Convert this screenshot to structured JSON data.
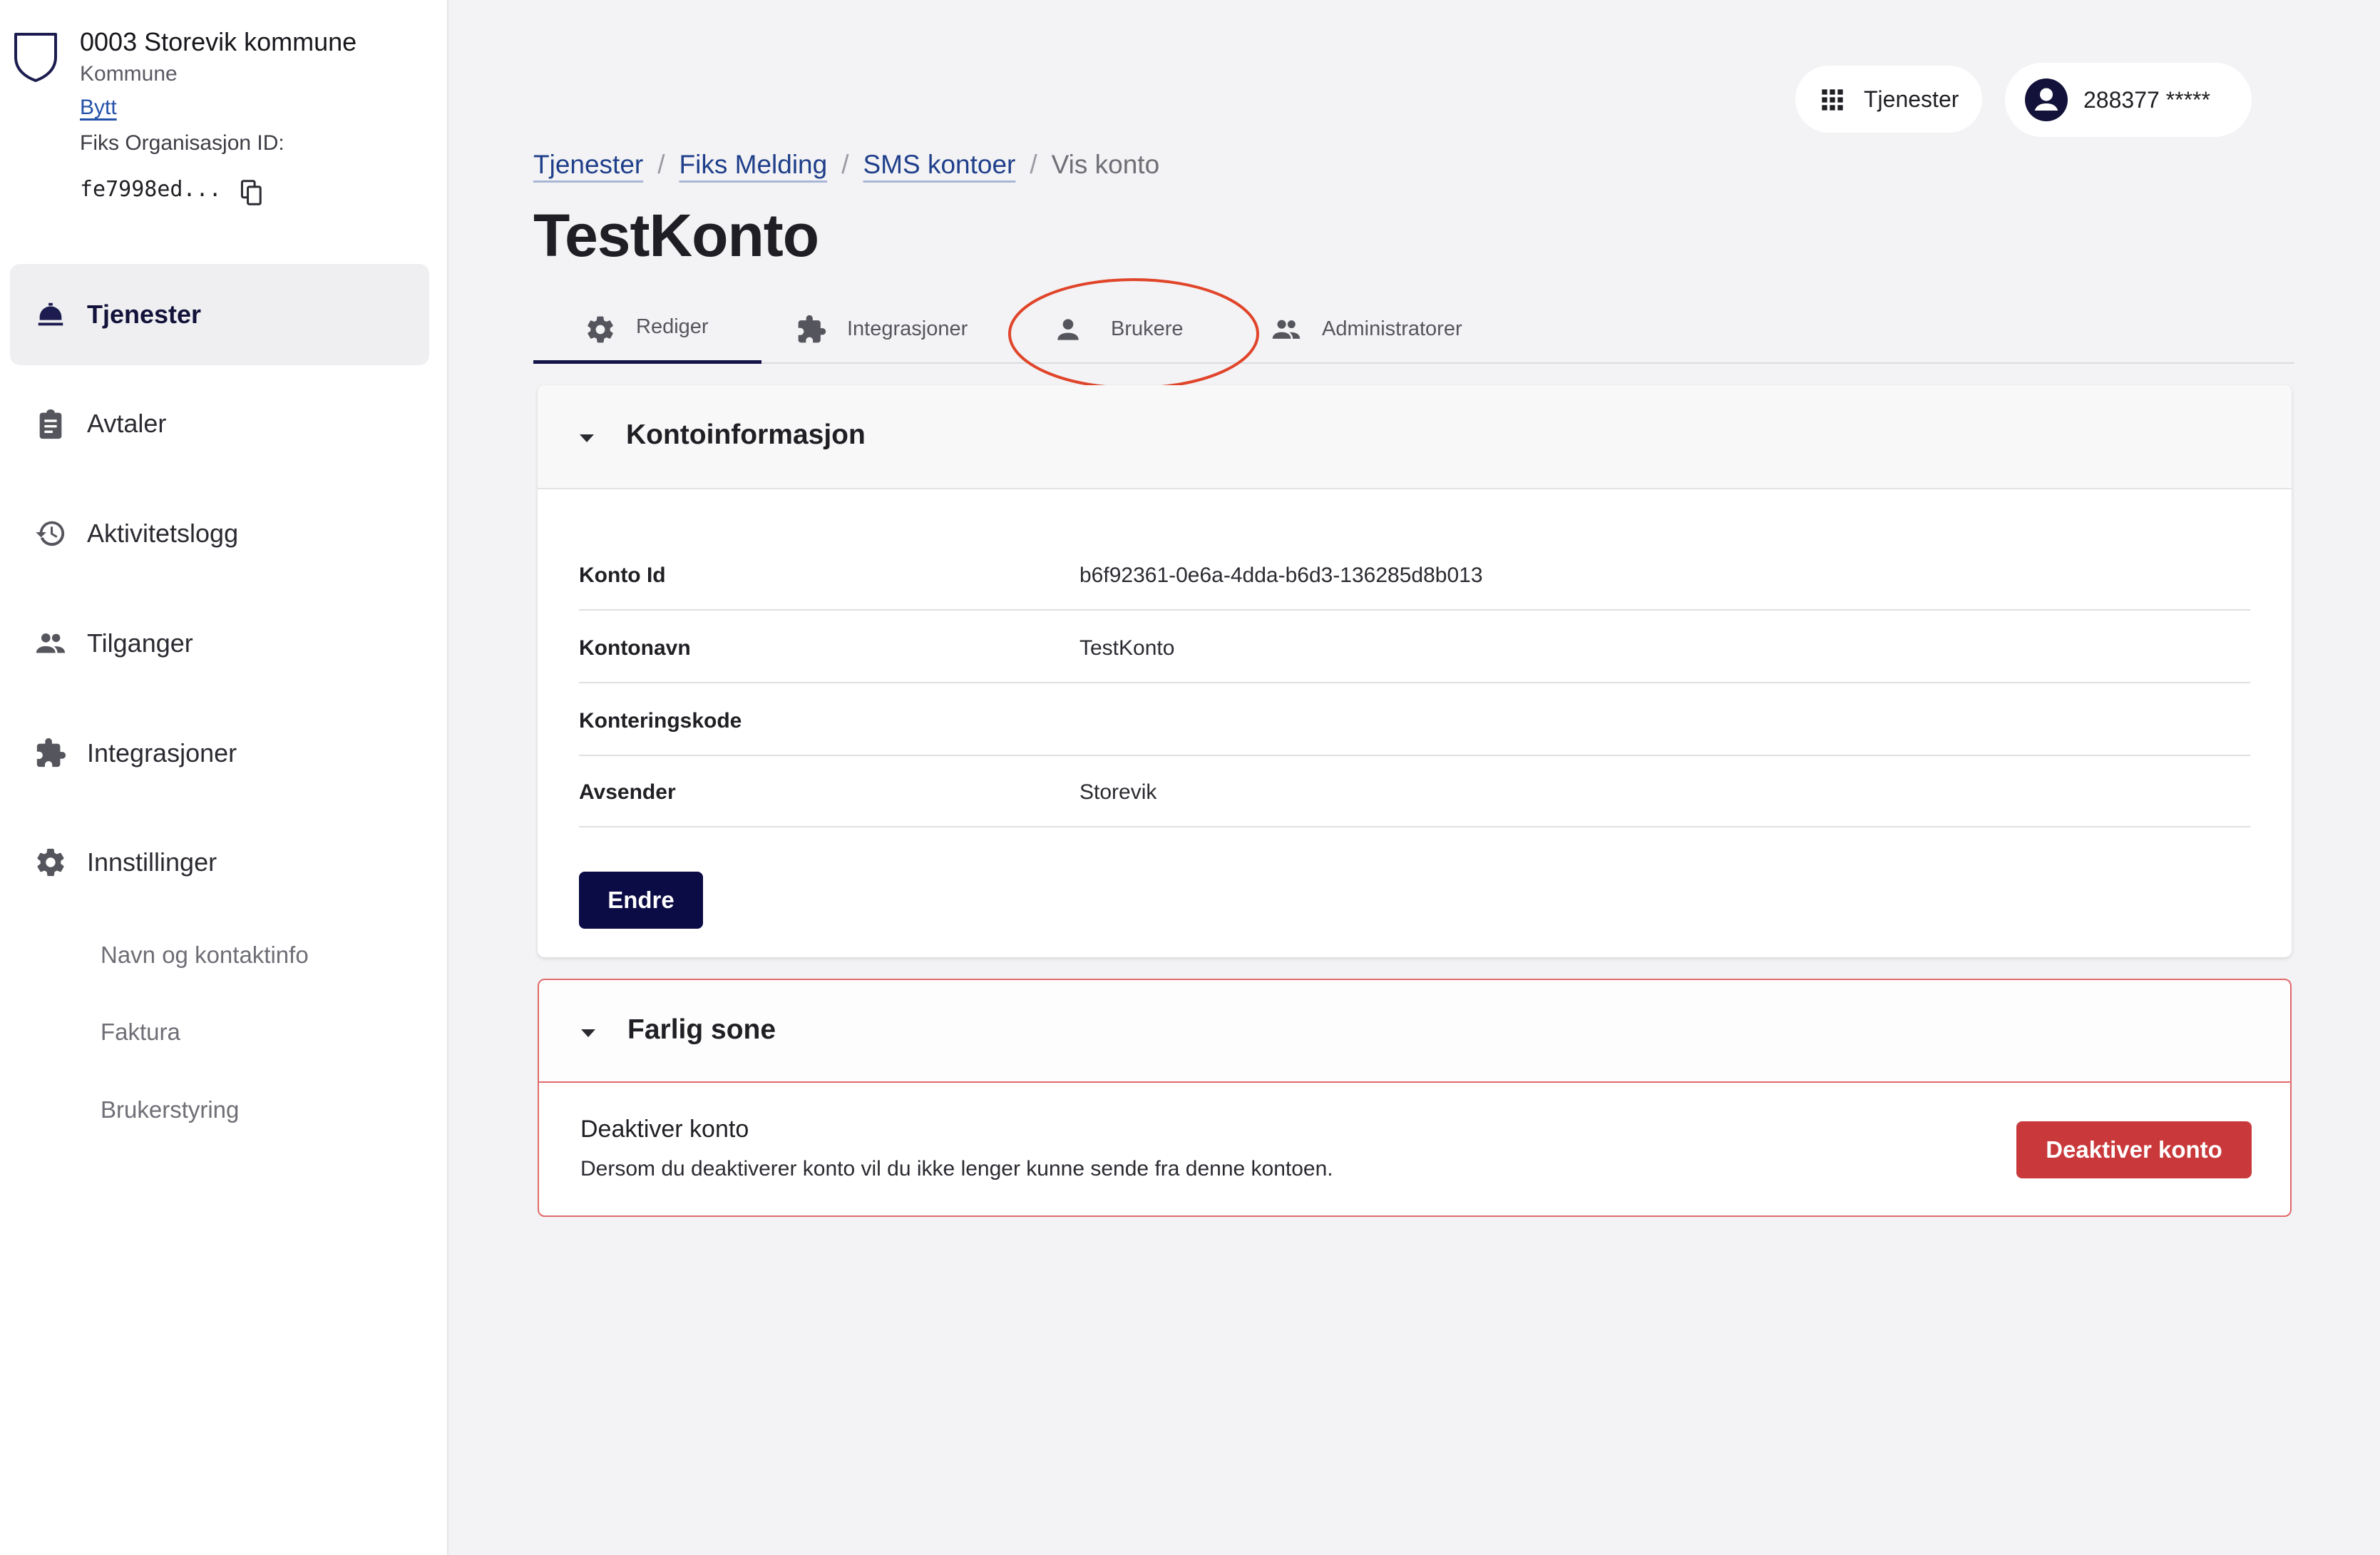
{
  "sidebar": {
    "org_name": "0003 Storevik kommune",
    "org_type": "Kommune",
    "switch_label": "Bytt",
    "org_id_label": "Fiks Organisasjon ID:",
    "org_id_value": "fe7998ed...",
    "nav": [
      {
        "label": "Tjenester",
        "icon": "service-bell-icon",
        "active": true
      },
      {
        "label": "Avtaler",
        "icon": "clipboard-icon",
        "active": false
      },
      {
        "label": "Aktivitetslogg",
        "icon": "history-icon",
        "active": false
      },
      {
        "label": "Tilganger",
        "icon": "people-icon",
        "active": false
      },
      {
        "label": "Integrasjoner",
        "icon": "puzzle-icon",
        "active": false
      },
      {
        "label": "Innstillinger",
        "icon": "gear-icon",
        "active": false
      }
    ],
    "sub_items": [
      {
        "label": "Navn og kontaktinfo"
      },
      {
        "label": "Faktura"
      },
      {
        "label": "Brukerstyring"
      }
    ]
  },
  "topbar": {
    "services_label": "Tjenester",
    "user_label": "288377 *****"
  },
  "breadcrumb": {
    "items": [
      "Tjenester",
      "Fiks Melding",
      "SMS kontoer"
    ],
    "current": "Vis konto"
  },
  "page_title": "TestKonto",
  "tabs": [
    {
      "label": "Rediger",
      "icon": "gear-icon",
      "active": true
    },
    {
      "label": "Integrasjoner",
      "icon": "puzzle-icon",
      "active": false
    },
    {
      "label": "Brukere",
      "icon": "person-icon",
      "active": false
    },
    {
      "label": "Administratorer",
      "icon": "people-icon",
      "active": false
    }
  ],
  "annotation": {
    "color": "#e0452a",
    "target": "Brukere"
  },
  "account_card": {
    "title": "Kontoinformasjon",
    "rows": [
      {
        "key": "Konto Id",
        "value": "b6f92361-0e6a-4dda-b6d3-136285d8b013"
      },
      {
        "key": "Kontonavn",
        "value": "TestKonto"
      },
      {
        "key": "Konteringskode",
        "value": ""
      },
      {
        "key": "Avsender",
        "value": "Storevik"
      }
    ],
    "edit_button": "Endre"
  },
  "danger_card": {
    "title": "Farlig sone",
    "action_title": "Deaktiver konto",
    "action_desc": "Dersom du deaktiverer konto vil du ikke lenger kunne sende fra denne kontoen.",
    "button": "Deaktiver konto"
  },
  "colors": {
    "primary": "#0b0b45",
    "danger": "#c9393b",
    "link": "#1f3f8a",
    "background": "#f3f3f5"
  }
}
